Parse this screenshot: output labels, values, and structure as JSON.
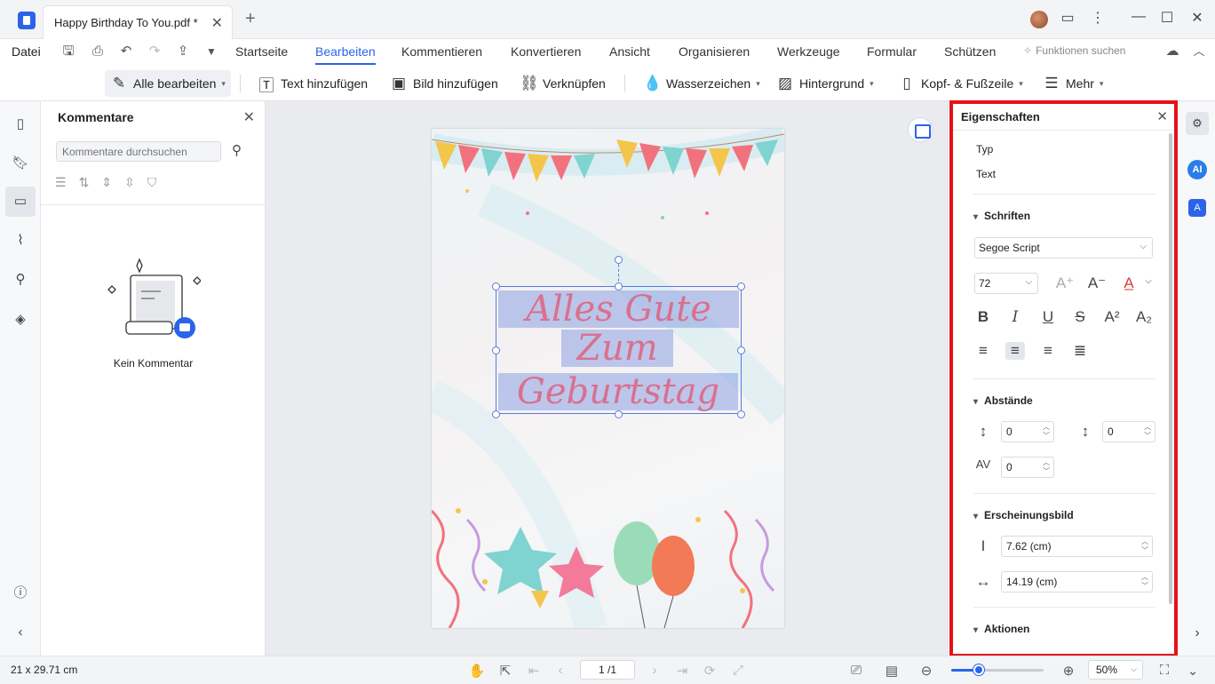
{
  "window": {
    "tab_title": "Happy Birthday To You.pdf *",
    "close_glyph": "✕",
    "new_tab_glyph": "+",
    "minimize_glyph": "—",
    "maximize_glyph": "☐",
    "close_window_glyph": "✕"
  },
  "menu": {
    "file": "Datei",
    "tabs": [
      "Startseite",
      "Bearbeiten",
      "Kommentieren",
      "Konvertieren",
      "Ansicht",
      "Organisieren",
      "Werkzeuge",
      "Formular",
      "Schützen"
    ],
    "active_tab": "Bearbeiten",
    "function_search": "Funktionen suchen"
  },
  "toolbar": {
    "edit_all": "Alle bearbeiten",
    "add_text": "Text hinzufügen",
    "add_image": "Bild hinzufügen",
    "link": "Verknüpfen",
    "watermark": "Wasserzeichen",
    "background": "Hintergrund",
    "header_footer": "Kopf- & Fußzeile",
    "more": "Mehr"
  },
  "comments": {
    "title": "Kommentare",
    "search_placeholder": "Kommentare durchsuchen",
    "empty_text": "Kein Kommentar"
  },
  "document": {
    "greeting_lines": [
      "Alles Gute",
      "Zum",
      "Geburtstag"
    ]
  },
  "properties": {
    "title": "Eigenschaften",
    "type_label": "Typ",
    "type_value": "Text",
    "fonts_section": "Schriften",
    "font_name": "Segoe Script",
    "font_size": "72",
    "spacing_section": "Abstände",
    "line_spacing": "0",
    "paragraph_spacing": "0",
    "char_spacing": "0",
    "appearance_section": "Erscheinungsbild",
    "height_value": "7.62 (cm)",
    "width_value": "14.19 (cm)",
    "actions_section": "Aktionen"
  },
  "right_rail": {
    "ai_label": "AI"
  },
  "statusbar": {
    "page_size": "21 x 29.71 cm",
    "page_indicator": "1 /1",
    "zoom": "50%",
    "zoom_fraction": 0.3
  }
}
